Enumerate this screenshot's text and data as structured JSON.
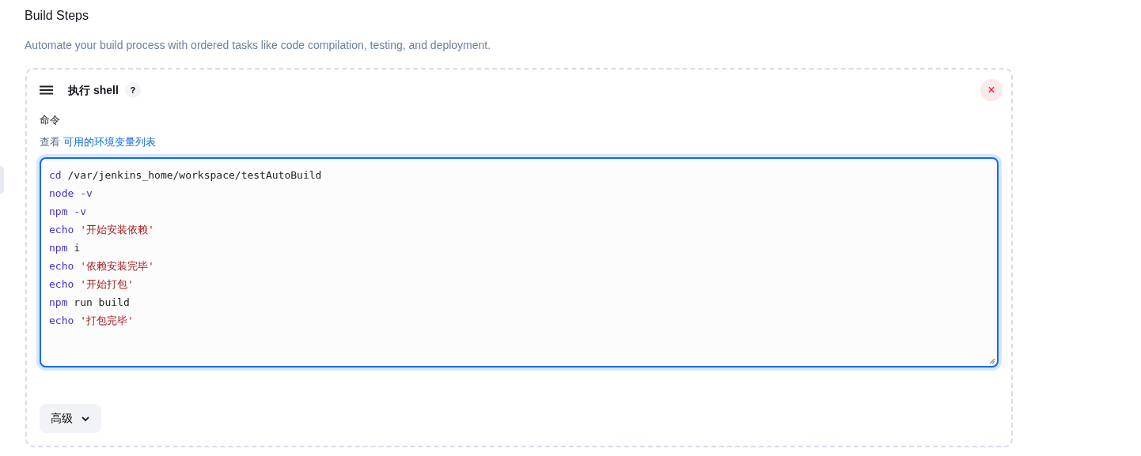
{
  "section": {
    "title": "Build Steps",
    "description": "Automate your build process with ordered tasks like code compilation, testing, and deployment."
  },
  "step": {
    "title": "执行 shell",
    "help": "?",
    "close": "×",
    "field_label": "命令",
    "env_prefix": "查看",
    "env_link": "可用的环境变量列表",
    "code_lines": [
      [
        {
          "kind": "keyword",
          "text": "cd"
        },
        {
          "kind": "plain",
          "text": "/var/jenkins_home/workspace/testAutoBuild"
        }
      ],
      [
        {
          "kind": "keyword",
          "text": "node -v"
        }
      ],
      [
        {
          "kind": "keyword",
          "text": "npm -v"
        }
      ],
      [
        {
          "kind": "keyword",
          "text": "echo"
        },
        {
          "kind": "string",
          "text": "'开始安装依赖'"
        }
      ],
      [
        {
          "kind": "keyword",
          "text": "npm"
        },
        {
          "kind": "plain",
          "text": "i"
        }
      ],
      [
        {
          "kind": "keyword",
          "text": "echo"
        },
        {
          "kind": "string",
          "text": "'依赖安装完毕'"
        }
      ],
      [
        {
          "kind": "keyword",
          "text": "echo"
        },
        {
          "kind": "string",
          "text": "'开始打包'"
        }
      ],
      [
        {
          "kind": "keyword",
          "text": "npm"
        },
        {
          "kind": "plain",
          "text": "run build"
        }
      ],
      [
        {
          "kind": "keyword",
          "text": "echo"
        },
        {
          "kind": "string",
          "text": "'打包完毕'"
        }
      ]
    ],
    "editor_focused": true,
    "advanced_button": "高级"
  }
}
